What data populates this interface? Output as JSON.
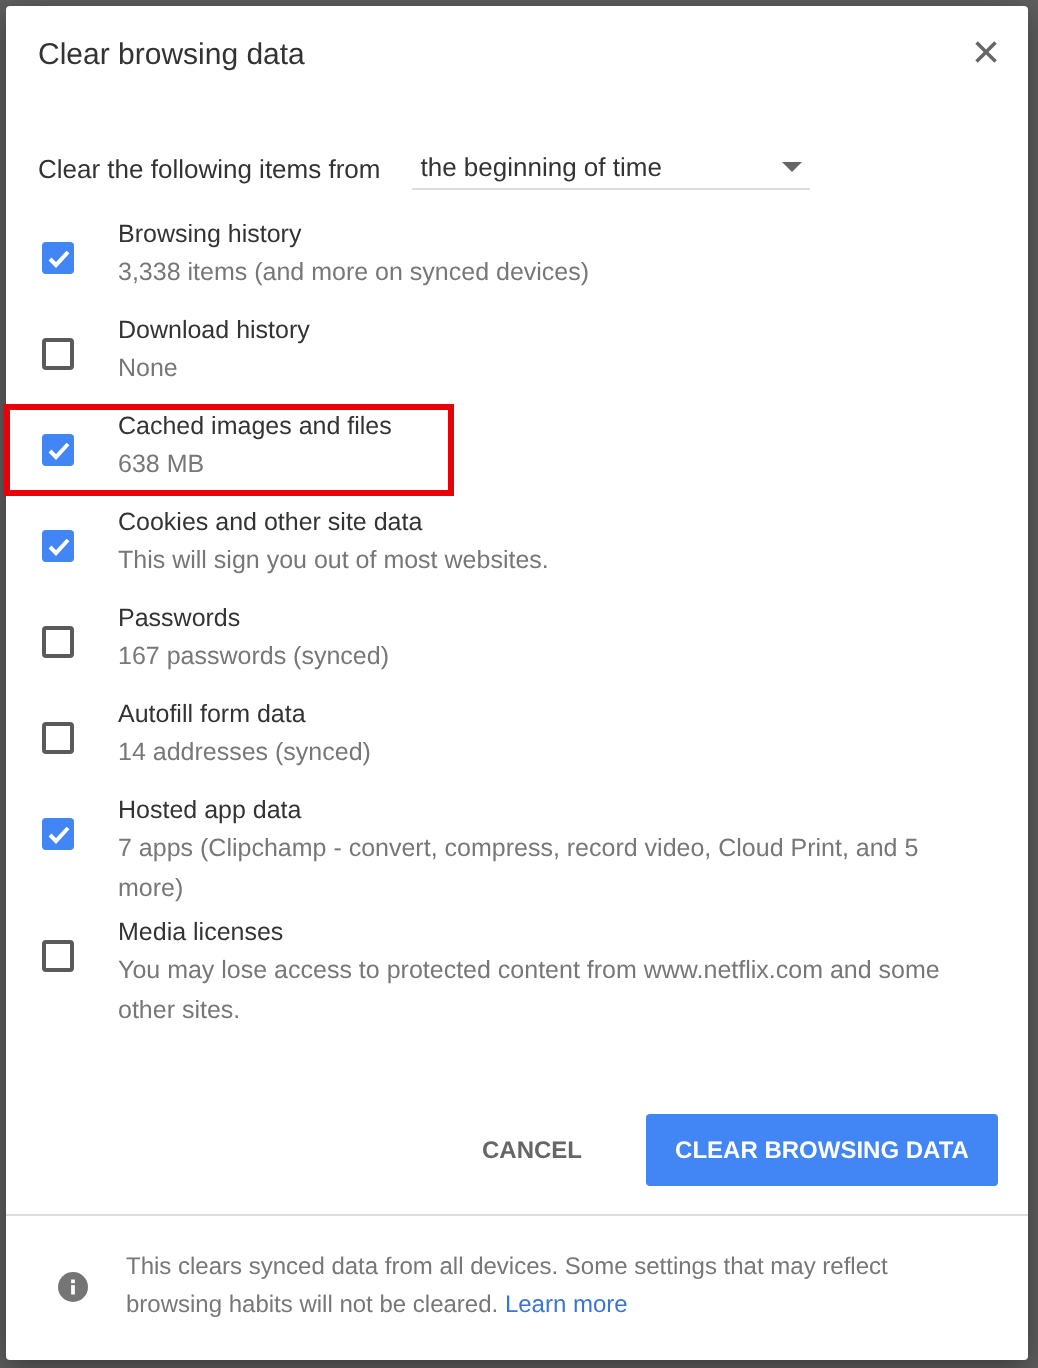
{
  "dialog": {
    "title": "Clear browsing data",
    "close": "×"
  },
  "range": {
    "label": "Clear the following items from",
    "value": "the beginning of time"
  },
  "items": [
    {
      "label": "Browsing history",
      "detail": "3,338 items (and more on synced devices)",
      "checked": true,
      "highlighted": false
    },
    {
      "label": "Download history",
      "detail": "None",
      "checked": false,
      "highlighted": false
    },
    {
      "label": "Cached images and files",
      "detail": "638 MB",
      "checked": true,
      "highlighted": true
    },
    {
      "label": "Cookies and other site data",
      "detail": "This will sign you out of most websites.",
      "checked": true,
      "highlighted": false
    },
    {
      "label": "Passwords",
      "detail": "167 passwords (synced)",
      "checked": false,
      "highlighted": false
    },
    {
      "label": "Autofill form data",
      "detail": "14 addresses (synced)",
      "checked": false,
      "highlighted": false
    },
    {
      "label": "Hosted app data",
      "detail": "7 apps (Clipchamp - convert, compress, record video, Cloud Print, and 5 more)",
      "checked": true,
      "highlighted": false
    },
    {
      "label": "Media licenses",
      "detail": "You may lose access to protected content from www.netflix.com and some other sites.",
      "checked": false,
      "highlighted": false
    }
  ],
  "buttons": {
    "cancel": "CANCEL",
    "confirm": "CLEAR BROWSING DATA"
  },
  "footer": {
    "text": "This clears synced data from all devices. Some settings that may reflect browsing habits will not be cleared.",
    "link": "Learn more"
  }
}
